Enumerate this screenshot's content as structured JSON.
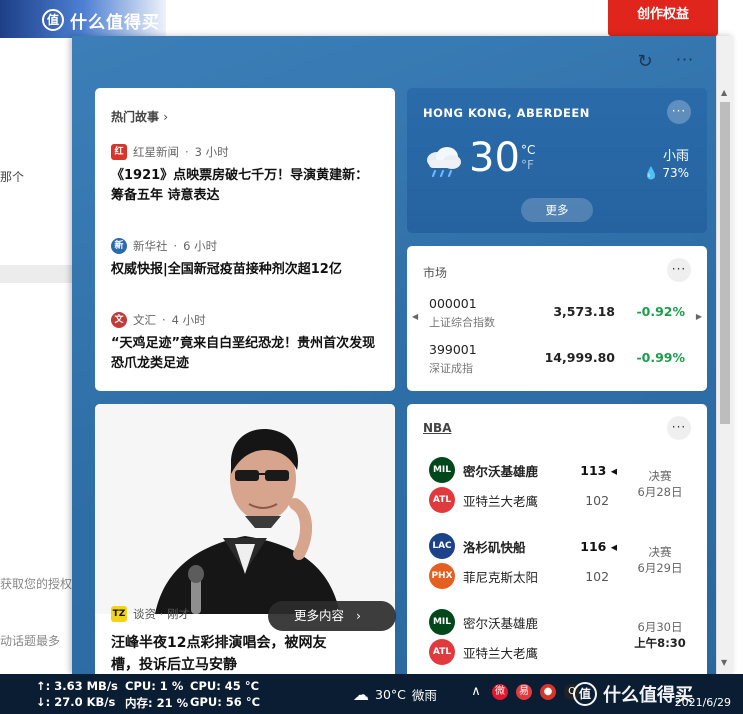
{
  "background": {
    "logo_text": "什么值得买",
    "red_box_text": "创作权益",
    "snippets": [
      "那个",
      "获取您的授权",
      "动话题最多"
    ]
  },
  "panel": {
    "refresh_icon": "refresh-icon",
    "more_icon": "ellipsis-icon"
  },
  "news_card": {
    "header": "热门故事",
    "items": [
      {
        "source": "红星新闻",
        "time": "3 小时",
        "title": "《1921》点映票房破七千万！导演黄建新：筹备五年 诗意表达",
        "icon_color": "#d8342a",
        "icon_text": "红"
      },
      {
        "source": "新华社",
        "time": "6 小时",
        "title": "权威快报|全国新冠疫苗接种剂次超12亿",
        "icon_color": "#2a6ab0",
        "icon_text": "新"
      },
      {
        "source": "文汇",
        "time": "4 小时",
        "title": "“天鸡足迹”竟来自白垩纪恐龙！贵州首次发现恐爪龙类足迹",
        "icon_color": "#c23a3a",
        "icon_text": "文"
      }
    ]
  },
  "weather_card": {
    "location": "HONG KONG, ABERDEEN",
    "temp": "30",
    "unit_c": "°C",
    "unit_f": "°F",
    "condition": "小雨",
    "humidity": "73%",
    "more_label": "更多"
  },
  "market_card": {
    "header": "市场",
    "rows": [
      {
        "code": "000001",
        "name": "上证综合指数",
        "price": "3,573.18",
        "change": "-0.92%"
      },
      {
        "code": "399001",
        "name": "深证成指",
        "price": "14,999.80",
        "change": "-0.99%"
      }
    ]
  },
  "photo_card": {
    "source": "谈资 · 刚才",
    "source_icon_text": "TZ",
    "title_line1": "汪峰半夜12点彩排演唱会，被网友",
    "title_line2": "槽，投诉后立马安静"
  },
  "nba_card": {
    "header": "NBA",
    "games": [
      {
        "home": "密尔沃基雄鹿",
        "home_score": "113",
        "away": "亚特兰大老鹰",
        "away_score": "102",
        "info1": "决赛",
        "info2": "6月28日",
        "home_color": "#00471b",
        "away_color": "#e03a3e",
        "home_abbr": "MIL",
        "away_abbr": "ATL"
      },
      {
        "home": "洛杉矶快船",
        "home_score": "116",
        "away": "菲尼克斯太阳",
        "away_score": "102",
        "info1": "决赛",
        "info2": "6月29日",
        "home_color": "#1d428a",
        "away_color": "#e56020",
        "home_abbr": "LAC",
        "away_abbr": "PHX"
      },
      {
        "home": "密尔沃基雄鹿",
        "home_score": "",
        "away": "亚特兰大老鹰",
        "away_score": "",
        "info1": "6月30日",
        "info2": "上午8:30",
        "home_color": "#00471b",
        "away_color": "#e03a3e",
        "home_abbr": "MIL",
        "away_abbr": "ATL"
      }
    ]
  },
  "more_content_label": "更多内容",
  "taskbar": {
    "upload": "↑: 3.63 MB/s",
    "download": "↓: 27.0 KB/s",
    "cpu_usage": "CPU: 1 %",
    "cpu_temp": "CPU: 45 °C",
    "mem": "内存: 21 %",
    "gpu": "GPU: 56 °C",
    "weather_temp": "30°C",
    "weather_cond": "微雨",
    "watermark": "什么值得买",
    "date": "2021/6/29"
  }
}
